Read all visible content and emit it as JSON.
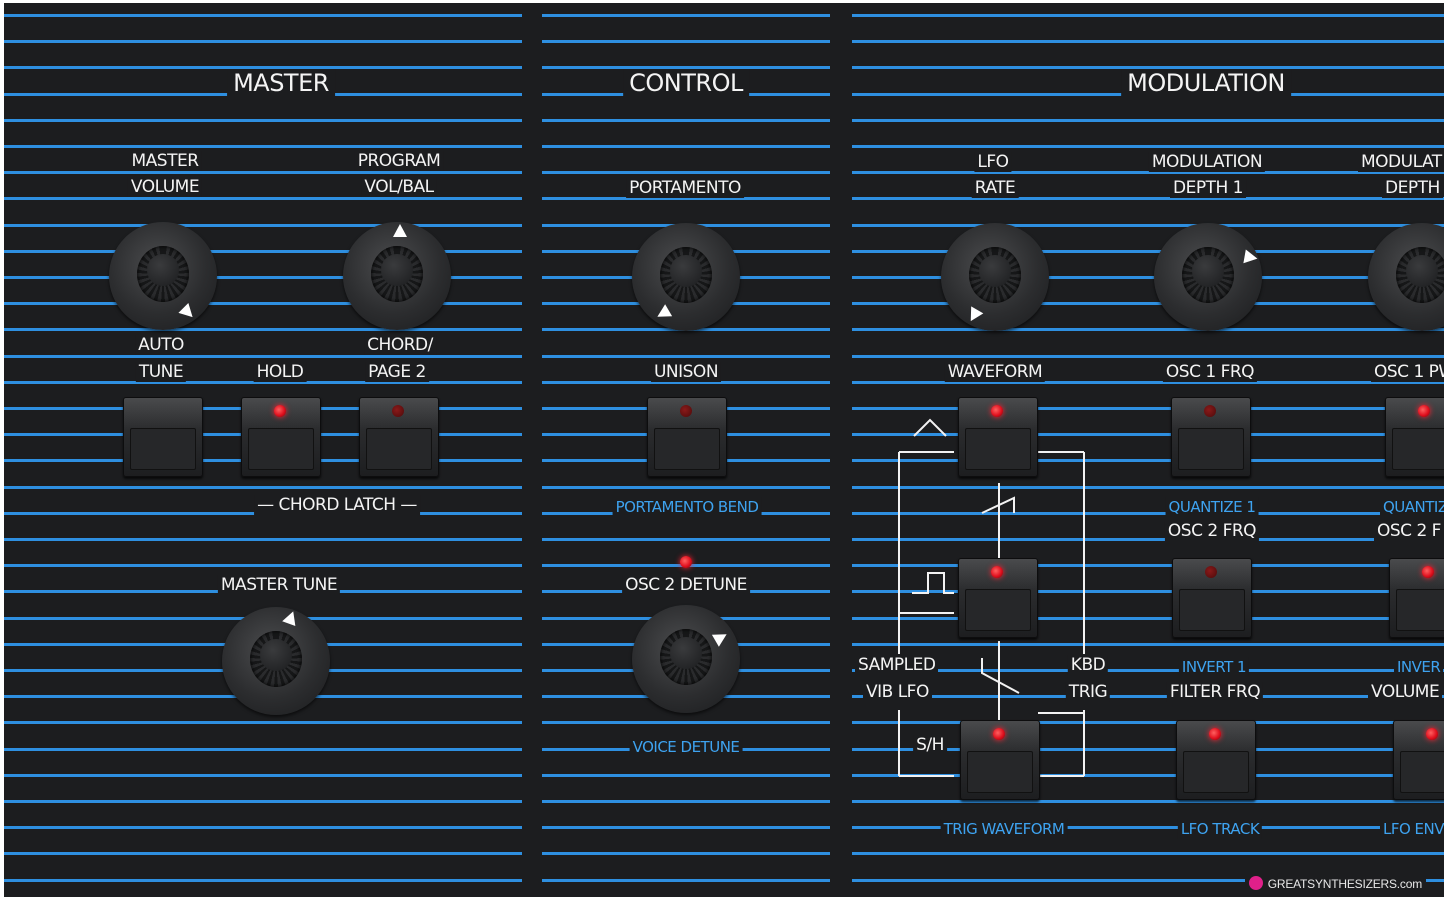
{
  "sections": {
    "master": "MASTER",
    "control": "CONTROL",
    "modulation": "MODULATION"
  },
  "master": {
    "volume_line1": "MASTER",
    "volume_line2": "VOLUME",
    "program_line1": "PROGRAM",
    "program_line2": "VOL/BAL",
    "auto_line1": "AUTO",
    "auto_line2": "TUNE",
    "hold": "HOLD",
    "chord_line1": "CHORD/",
    "chord_line2": "PAGE 2",
    "chord_latch": "— CHORD LATCH —",
    "master_tune": "MASTER TUNE"
  },
  "control": {
    "portamento": "PORTAMENTO",
    "unison": "UNISON",
    "portamento_bend": "PORTAMENTO BEND",
    "osc2_detune": "OSC 2 DETUNE",
    "voice_detune": "VOICE DETUNE"
  },
  "modulation": {
    "lfo_line1": "LFO",
    "lfo_line2": "RATE",
    "depth1_line1": "MODULATION",
    "depth1_line2": "DEPTH 1",
    "depth2_line1": "MODULAT",
    "depth2_line2": "DEPTH",
    "waveform": "WAVEFORM",
    "sampled_line1": "SAMPLED",
    "sampled_line2": "VIB LFO",
    "kbd_line1": "KBD",
    "kbd_line2": "TRIG",
    "sh": "S/H",
    "trig_waveform": "TRIG WAVEFORM",
    "osc1_frq": "OSC 1 FRQ",
    "quantize1": "QUANTIZE 1",
    "osc2_frq": "OSC 2 FRQ",
    "invert1": "INVERT 1",
    "filter_frq": "FILTER FRQ",
    "lfo_track": "LFO TRACK",
    "osc1_pw": "OSC 1 PW",
    "quantize2": "QUANTIZ",
    "osc2_col3": "OSC 2 F",
    "invert2": "INVER",
    "volume": "VOLUME",
    "lfo_env": "LFO ENV"
  },
  "footer": {
    "logo": "GREATSYNTHESIZERS.com"
  },
  "colors": {
    "panel": "#1c1d1f",
    "stripe": "#2e8fe0",
    "legend_white": "#f4f4f4",
    "legend_blue": "#3ea3f0",
    "led_on": "#e0101e"
  },
  "leds": {
    "hold": true,
    "chord_page2": false,
    "unison": false,
    "detune": true,
    "waveform_tri": true,
    "waveform_square": true,
    "waveform_sh": true,
    "osc1_frq": false,
    "osc2_frq": false,
    "filter_frq": true,
    "col3_top": true,
    "col3_mid": true,
    "col3_bot": true
  }
}
